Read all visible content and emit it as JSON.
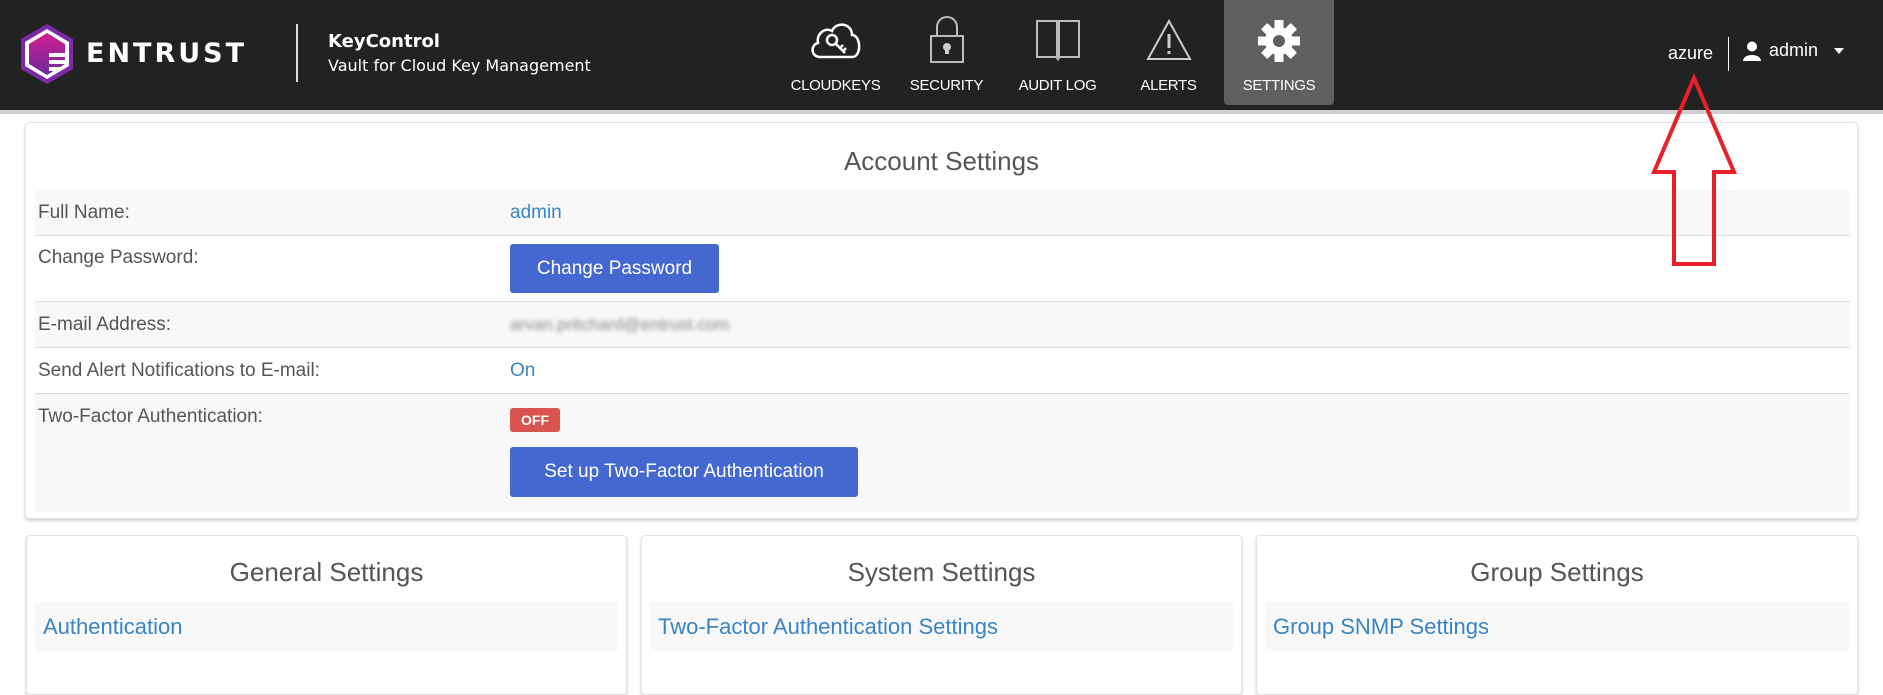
{
  "header": {
    "brand": "ENTRUST",
    "product_name": "KeyControl",
    "product_subtitle": "Vault for Cloud Key Management",
    "nav": [
      {
        "label": "CLOUDKEYS",
        "icon": "cloud-key-icon",
        "active": false
      },
      {
        "label": "SECURITY",
        "icon": "lock-icon",
        "active": false
      },
      {
        "label": "AUDIT LOG",
        "icon": "book-icon",
        "active": false
      },
      {
        "label": "ALERTS",
        "icon": "warning-icon",
        "active": false
      },
      {
        "label": "SETTINGS",
        "icon": "gear-icon",
        "active": true
      }
    ],
    "environment": "azure",
    "user": "admin"
  },
  "account_settings": {
    "title": "Account Settings",
    "rows": {
      "full_name": {
        "label": "Full Name:",
        "value": "admin"
      },
      "change_password": {
        "label": "Change Password:",
        "button": "Change Password"
      },
      "email": {
        "label": "E-mail Address:",
        "value": "arvan.pritchard@entrust.com"
      },
      "alerts": {
        "label": "Send Alert Notifications to E-mail:",
        "value": "On"
      },
      "two_factor": {
        "label": "Two-Factor Authentication:",
        "status": "OFF",
        "button": "Set up Two-Factor Authentication"
      }
    }
  },
  "cards": {
    "general": {
      "title": "General Settings",
      "link": "Authentication"
    },
    "system": {
      "title": "System Settings",
      "link": "Two-Factor Authentication Settings"
    },
    "group": {
      "title": "Group Settings",
      "link": "Group SNMP Settings"
    }
  },
  "colors": {
    "header_bg": "#222222",
    "active_tab": "#5f5f5f",
    "primary_button": "#4468d0",
    "link": "#3a84c4",
    "badge_off": "#d9534f",
    "annotation_arrow": "#e8202a"
  }
}
